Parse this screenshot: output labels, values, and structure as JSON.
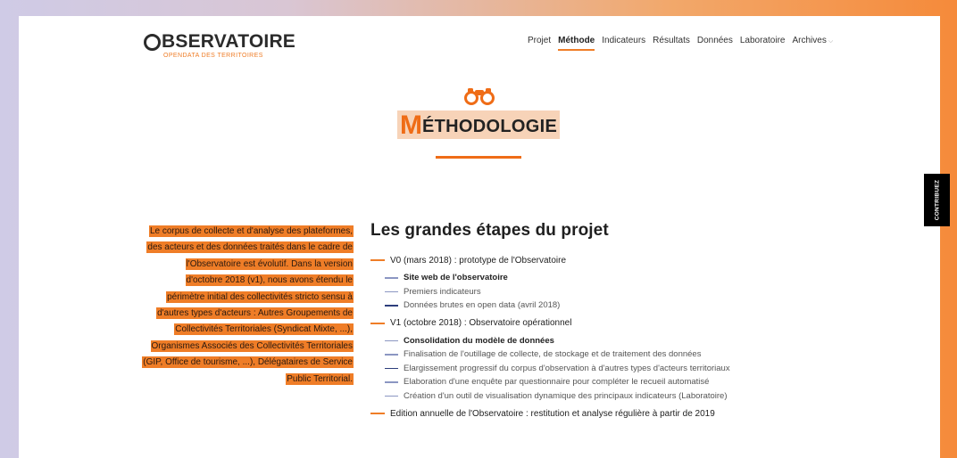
{
  "logo": {
    "main": "BSERVATOIRE",
    "sub": "OPENDATA DES TERRITOIRES"
  },
  "nav": [
    {
      "label": "Projet",
      "active": false
    },
    {
      "label": "Méthode",
      "active": true
    },
    {
      "label": "Indicateurs",
      "active": false
    },
    {
      "label": "Résultats",
      "active": false
    },
    {
      "label": "Données",
      "active": false
    },
    {
      "label": "Laboratoire",
      "active": false
    },
    {
      "label": "Archives",
      "active": false
    }
  ],
  "page": {
    "title_first": "M",
    "title_rest": "ÉTHODOLOGIE"
  },
  "contribuez": "CONTRIBUEZ",
  "intro_lines": [
    "Le corpus de collecte et d'analyse des plateformes,",
    "des acteurs et des données traités dans le cadre de",
    "l'Observatoire est évolutif. Dans la version",
    "d'octobre 2018 (v1), nous avons étendu le",
    "périmètre initial des collectivités stricto sensu à",
    "d'autres types d'acteurs : Autres Groupements de",
    "Collectivités Territoriales (Syndicat Mixte, ...),",
    "Organismes Associés des Collectivités Territoriales",
    "(GIP, Office de tourisme, ...), Délégataires de Service",
    "Public Territorial."
  ],
  "section_title": "Les grandes étapes du projet",
  "steps": {
    "v0": "V0 (mars 2018) : prototype de l'Observatoire",
    "v0_items": [
      "Site web de l'observatoire",
      "Premiers indicateurs",
      "Données brutes en open data (avril 2018)"
    ],
    "v1": "V1 (octobre 2018) : Observatoire opérationnel",
    "v1_items": [
      "Consolidation du modèle de données",
      "Finalisation de l'outillage de collecte, de stockage et de traitement des données",
      "Elargissement progressif du corpus d'observation à d'autres types d'acteurs territoriaux",
      "Elaboration d'une enquête par questionnaire pour compléter le recueil automatisé",
      "Création d'un outil de visualisation dynamique des principaux indicateurs (Laboratoire)"
    ],
    "annual": "Edition annuelle de l'Observatoire : restitution et analyse régulière à partir de 2019"
  },
  "colors": {
    "accent": "#ef7d27",
    "navy": "#2d3e7c"
  }
}
